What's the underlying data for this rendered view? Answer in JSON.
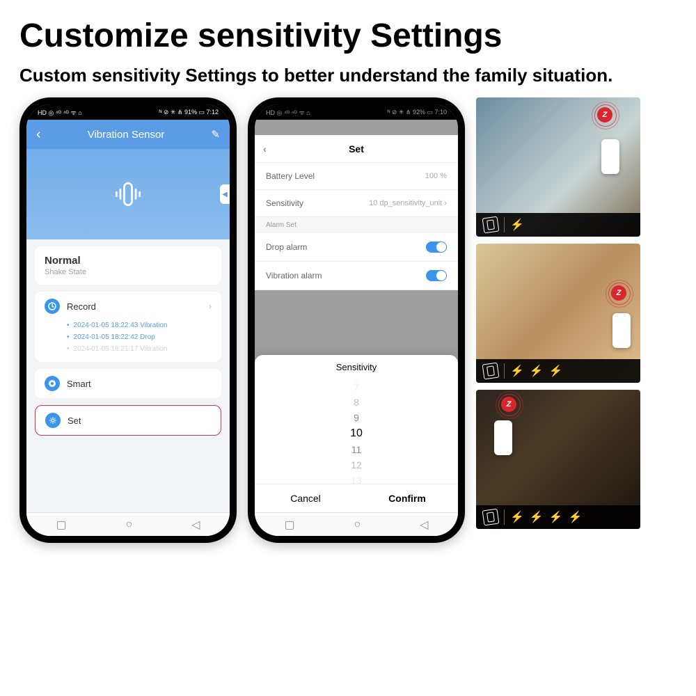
{
  "heading": "Customize sensitivity Settings",
  "subheading": "Custom sensitivity Settings to better understand the family situation.",
  "phone1": {
    "status": {
      "left": "HD ◎ ⁴ᴳ ⁴ᴳ ᯤ ⌂",
      "right": "ᴺ ⊘ ✳ ⋔ 91% ▭ 7:12"
    },
    "header": {
      "title": "Vibration Sensor",
      "back": "‹",
      "edit": "✎"
    },
    "state": {
      "title": "Normal",
      "sub": "Shake State"
    },
    "record": {
      "label": "Record",
      "items": [
        "2024-01-05 18:22:43 Vibration",
        "2024-01-05 18:22:42 Drop",
        "2024-01-05 18:21:17 Vibration"
      ]
    },
    "smart": "Smart",
    "set": "Set"
  },
  "phone2": {
    "status": {
      "left": "HD ◎ ⁴ᴳ ⁴ᴳ ᯤ ⌂",
      "right": "ᴺ ⊘ ✳ ⋔ 92% ▭ 7:10"
    },
    "set_title": "Set",
    "rows": {
      "battery": {
        "label": "Battery Level",
        "value": "100 %"
      },
      "sensitivity": {
        "label": "Sensitivity",
        "value": "10 dp_sensitivity_unit"
      },
      "section": "Alarm Set",
      "drop": "Drop alarm",
      "vib": "Vibration alarm"
    },
    "picker": {
      "title": "Sensitivity",
      "options": [
        "7",
        "8",
        "9",
        "10",
        "11",
        "12",
        "13"
      ],
      "selected": "10",
      "cancel": "Cancel",
      "confirm": "Confirm"
    }
  },
  "scenes": {
    "zigbee": "Z",
    "bolts": [
      "1",
      "3",
      "4"
    ]
  }
}
